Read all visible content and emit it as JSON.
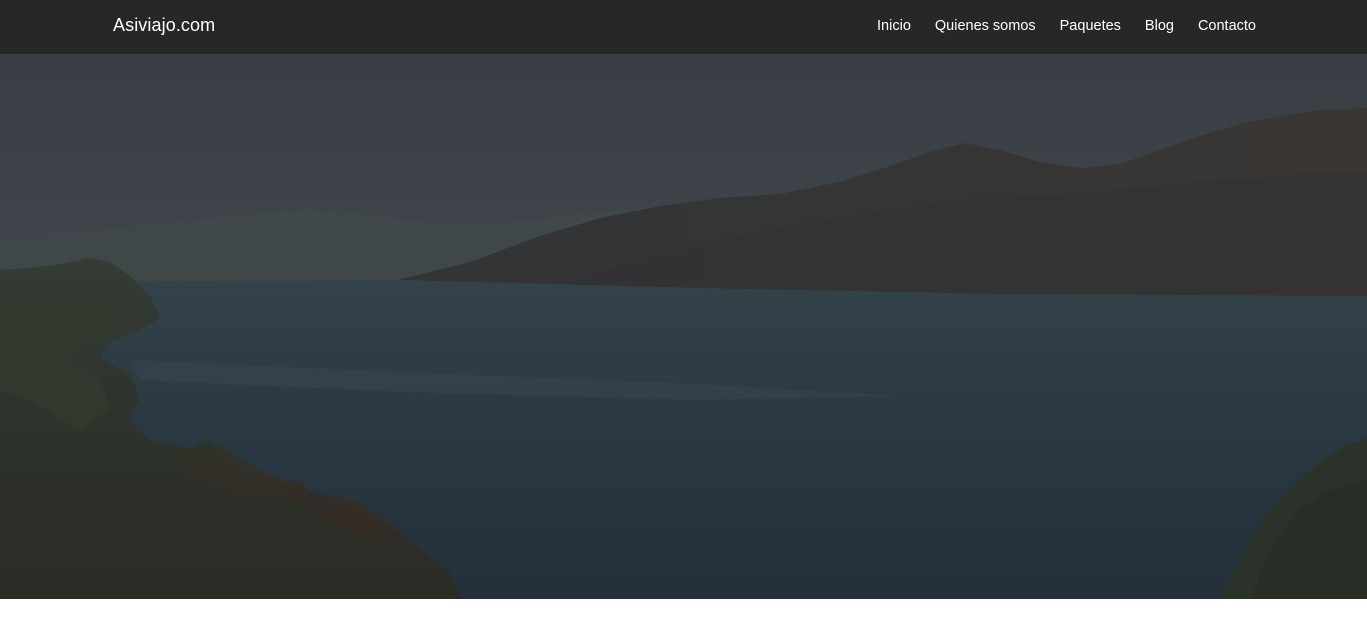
{
  "navbar": {
    "brand": "Asiviajo.com",
    "links": [
      {
        "label": "Inicio"
      },
      {
        "label": "Quienes somos"
      },
      {
        "label": "Paquetes"
      },
      {
        "label": "Blog"
      },
      {
        "label": "Contacto"
      }
    ]
  },
  "hero": {
    "image_subject": "lake-mountains-landscape",
    "overlay_color": "#1e2226"
  },
  "colors": {
    "navbar_bg": "#252628",
    "text": "#ffffff",
    "page_bg": "#ffffff"
  }
}
